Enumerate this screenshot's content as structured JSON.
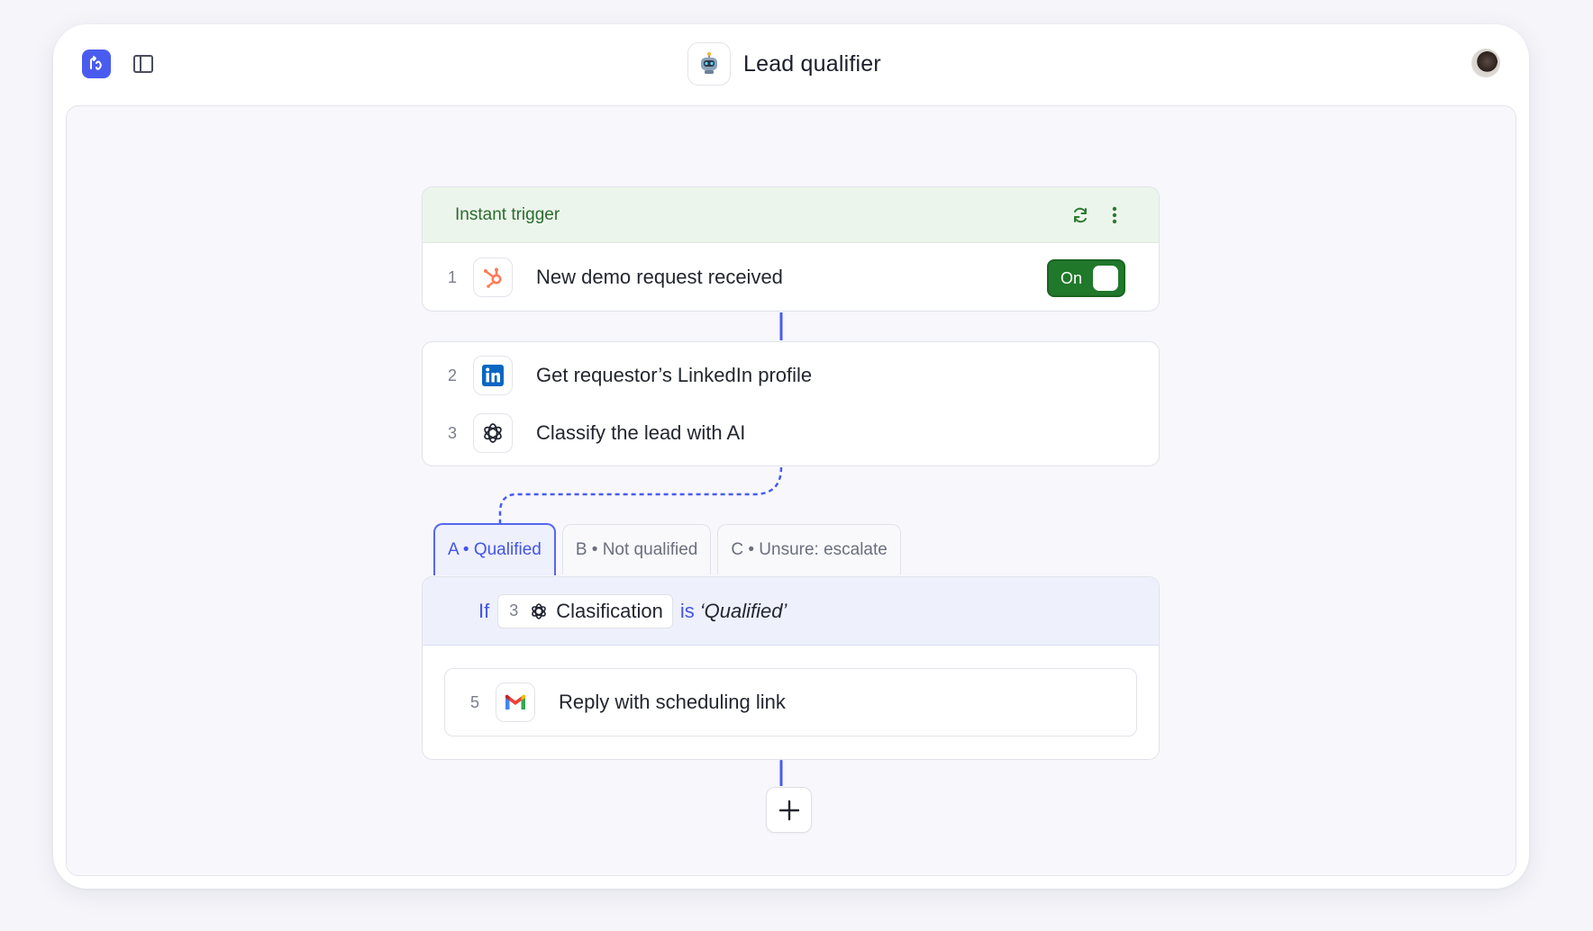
{
  "header": {
    "title": "Lead qualifier",
    "logo_icon": "app-logo-icon",
    "sidebar_icon": "sidebar-toggle-icon",
    "bot_icon": "robot-icon",
    "avatar_icon": "user-avatar"
  },
  "colors": {
    "accent": "#4a5cf0",
    "trigger_green": "#2c6b2f",
    "toggle_green": "#20782a",
    "branch_blue": "#4355e6"
  },
  "trigger": {
    "header_label": "Instant trigger",
    "refresh_icon": "refresh-icon",
    "more_icon": "more-vertical-icon",
    "step": {
      "number": "1",
      "icon": "hubspot-icon",
      "label": "New demo request received"
    },
    "toggle": {
      "label": "On",
      "state": true
    }
  },
  "steps": [
    {
      "number": "2",
      "icon": "linkedin-icon",
      "label": "Get requestor’s LinkedIn profile"
    },
    {
      "number": "3",
      "icon": "openai-icon",
      "label": "Classify the lead with AI"
    }
  ],
  "branch_tabs": [
    {
      "label": "A • Qualified",
      "active": true
    },
    {
      "label": "B • Not qualified",
      "active": false
    },
    {
      "label": "C • Unsure: escalate",
      "active": false
    }
  ],
  "condition": {
    "if_label": "If",
    "chip_number": "3",
    "chip_icon": "openai-icon",
    "chip_label": "Clasification",
    "operator": "is",
    "value": "‘Qualified’"
  },
  "branch_step": {
    "number": "5",
    "icon": "gmail-icon",
    "label": "Reply with scheduling link"
  },
  "add_button_icon": "plus-icon"
}
